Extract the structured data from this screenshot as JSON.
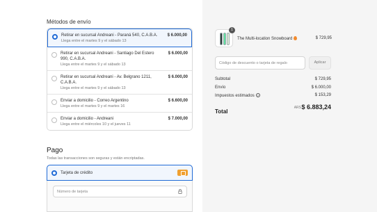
{
  "shipping": {
    "title": "Métodos de envío",
    "options": [
      {
        "title": "Retirar en sucursal Andreani - Paraná 540, C.A.B.A.",
        "eta": "Llega entre el martes 9 y el sábado 13",
        "price": "$ 6.000,00",
        "selected": true
      },
      {
        "title": "Retirar en sucursal Andreani - Santiago Del Estero 990, C.A.B.A.",
        "eta": "Llega entre el martes 9 y el sábado 13",
        "price": "$ 6.000,00",
        "selected": false
      },
      {
        "title": "Retirar en sucursal Andreani - Av. Belgrano 1211, C.A.B.A.",
        "eta": "Llega entre el martes 9 y el sábado 13",
        "price": "$ 6.000,00",
        "selected": false
      },
      {
        "title": "Enviar a domicilio - Correo Argentino",
        "eta": "Llega entre el martes 9 y el martes 16",
        "price": "$ 6.600,00",
        "selected": false
      },
      {
        "title": "Enviar a domicilio - Andreani",
        "eta": "Llega entre el miércoles 10 y el jueves 11",
        "price": "$ 7.000,00",
        "selected": false
      }
    ]
  },
  "payment": {
    "title": "Pago",
    "subtitle": "Todas las transacciones son seguras y están encriptadas.",
    "method_label": "Tarjeta de crédito",
    "card_number_placeholder": "Número de tarjeta"
  },
  "summary": {
    "product": {
      "name": "The Multi-location Snowboard",
      "price": "$ 729,95",
      "quantity": "1",
      "board_colors": [
        "#2e3a3a",
        "#5fe3a1",
        "#e0ead8"
      ]
    },
    "discount_placeholder": "Código de descuento o tarjeta de regalo",
    "apply_label": "Aplicar",
    "subtotal_label": "Subtotal",
    "subtotal_value": "$ 729,95",
    "shipping_label": "Envío",
    "shipping_value": "$ 6.000,00",
    "taxes_label": "Impuestos estimados",
    "taxes_value": "$ 153,29",
    "total_label": "Total",
    "total_currency": "ARS",
    "total_value": "$ 6.883,24"
  },
  "colors": {
    "accent": "#1f6ad6",
    "card_badge": "#f0a030"
  }
}
